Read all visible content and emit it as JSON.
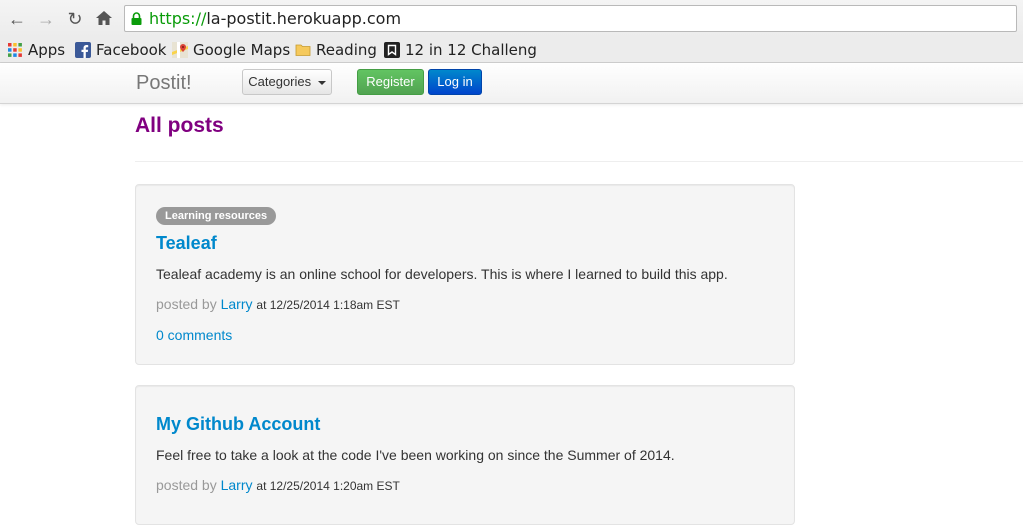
{
  "browser": {
    "url_scheme": "https://",
    "url_rest": "la-postit.herokuapp.com",
    "bookmarks": [
      {
        "label": "Apps",
        "icon": "apps-grid-icon"
      },
      {
        "label": "Facebook",
        "icon": "facebook-icon"
      },
      {
        "label": "Google Maps",
        "icon": "google-maps-icon"
      },
      {
        "label": "Reading",
        "icon": "folder-icon"
      },
      {
        "label": "12 in 12 Challeng",
        "icon": "bookmark-favicon-icon"
      }
    ]
  },
  "navbar": {
    "brand": "Postit!",
    "categories_label": "Categories",
    "register_label": "Register",
    "login_label": "Log in"
  },
  "page": {
    "title": "All posts"
  },
  "posts": [
    {
      "category": "Learning resources",
      "title": "Tealeaf",
      "description": "Tealeaf academy is an online school for developers. This is where I learned to build this app.",
      "posted_by_label": "posted by",
      "author": "Larry",
      "timestamp": "at 12/25/2014 1:18am EST",
      "comments": "0 comments"
    },
    {
      "title": "My Github Account",
      "description": "Feel free to take a look at the code I've been working on since the Summer of 2014.",
      "posted_by_label": "posted by",
      "author": "Larry",
      "timestamp": "at 12/25/2014 1:20am EST"
    }
  ],
  "colors": {
    "page_title": "#800080",
    "link": "#0088cc",
    "register": "#5cb85c",
    "login": "#0066cc"
  }
}
